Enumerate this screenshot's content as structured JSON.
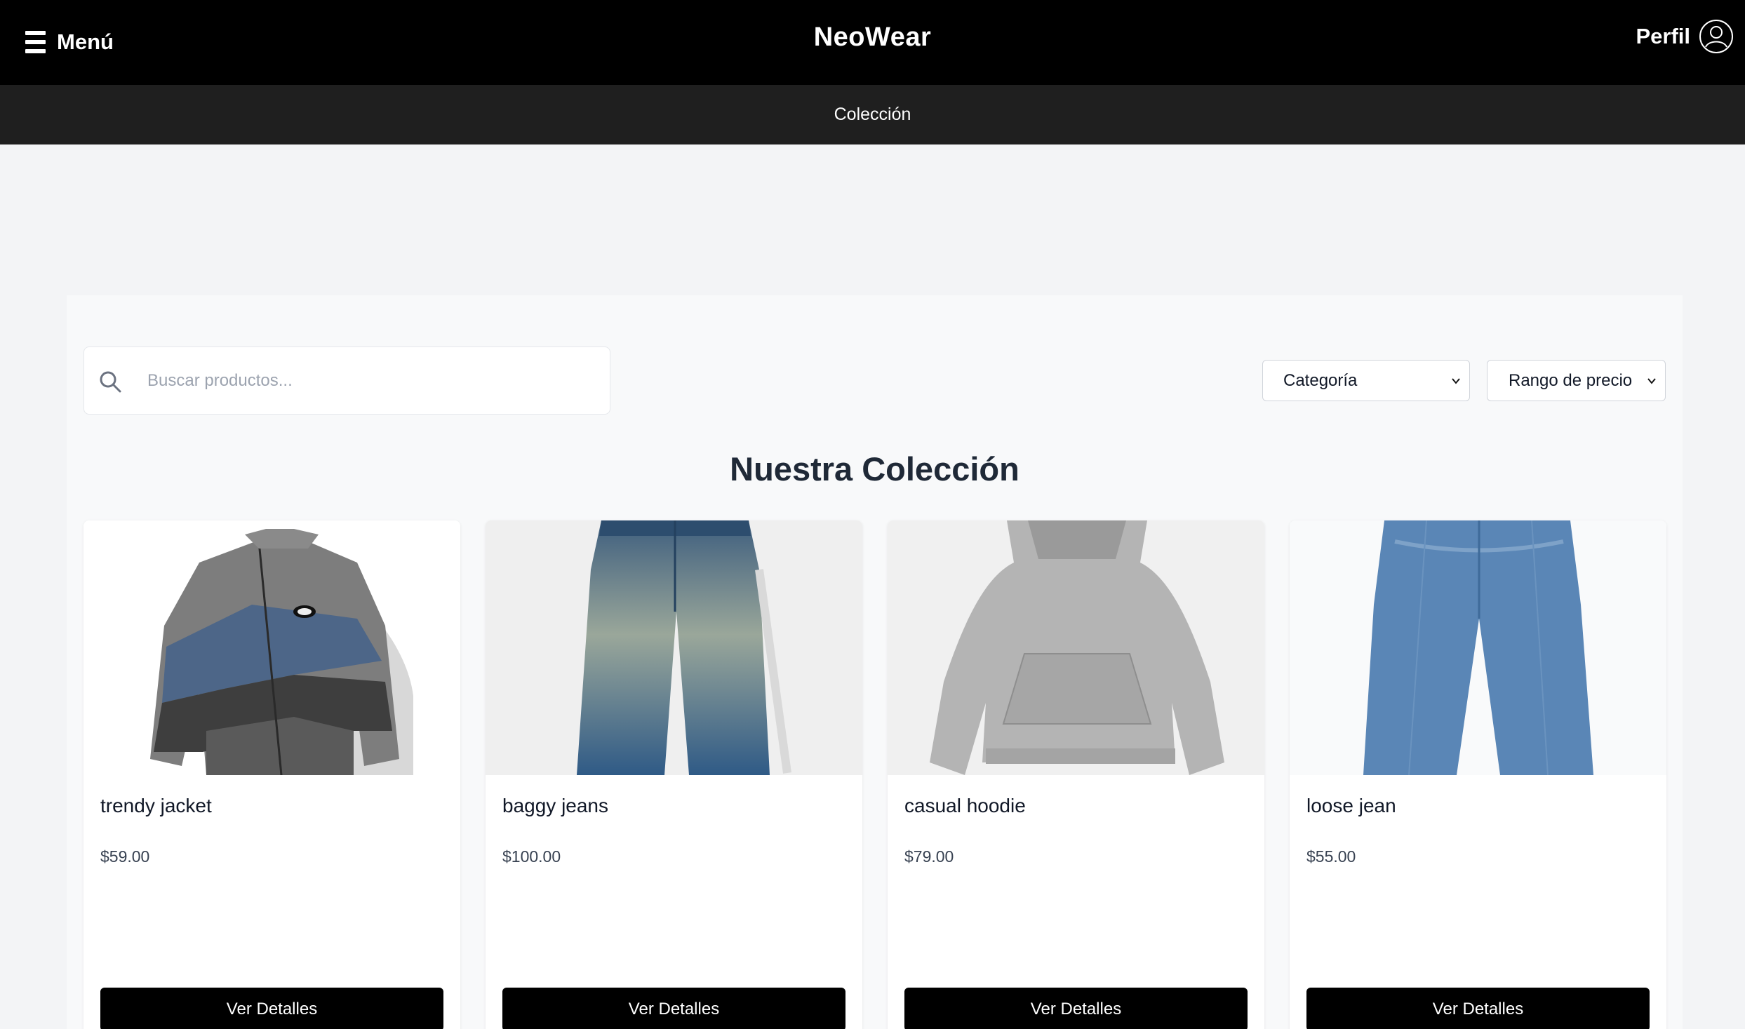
{
  "header": {
    "menu_label": "Menú",
    "brand": "NeoWear",
    "profile_label": "Perfil"
  },
  "subnav": {
    "link": "Colección"
  },
  "filters": {
    "search_placeholder": "Buscar productos...",
    "category_label": "Categoría",
    "price_label": "Rango de precio"
  },
  "section_title": "Nuestra Colección",
  "products": [
    {
      "name": "trendy jacket",
      "price": "$59.00",
      "button": "Ver Detalles",
      "icon": "jacket-image"
    },
    {
      "name": "baggy jeans",
      "price": "$100.00",
      "button": "Ver Detalles",
      "icon": "jeans-image"
    },
    {
      "name": "casual hoodie",
      "price": "$79.00",
      "button": "Ver Detalles",
      "icon": "hoodie-image"
    },
    {
      "name": "loose jean",
      "price": "$55.00",
      "button": "Ver Detalles",
      "icon": "jeans-image"
    }
  ],
  "colors": {
    "topbar": "#000000",
    "subbar": "#1f1f1f",
    "page_bg": "#f3f4f6",
    "button": "#000000"
  }
}
